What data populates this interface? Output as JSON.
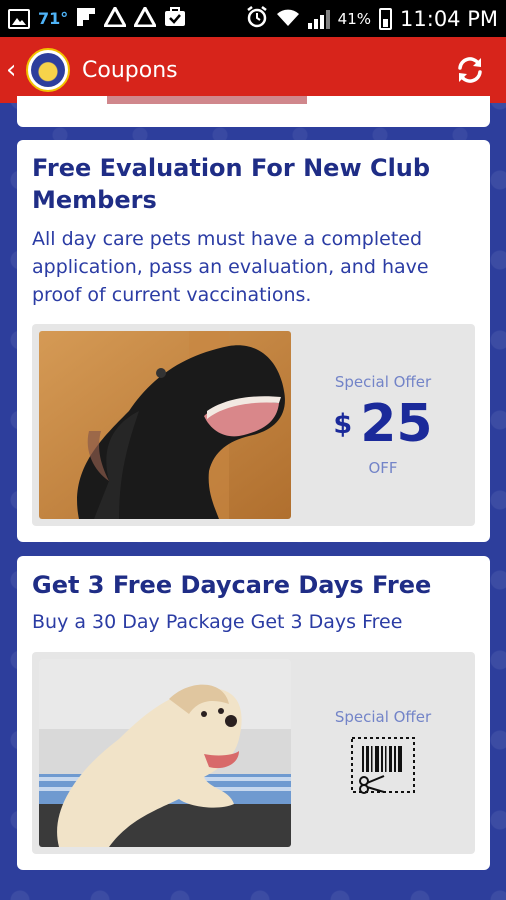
{
  "status_bar": {
    "temperature": "71°",
    "battery_percent": "41%",
    "time": "11:04 PM"
  },
  "app_bar": {
    "title": "Coupons",
    "back_icon": "chevron-left-icon",
    "refresh_icon": "refresh-icon",
    "accent_color": "#d7241b"
  },
  "coupons": [
    {
      "title": "Free Evaluation For New Club Members",
      "description": "All day care pets must have a completed application, pass an evaluation, and have proof of current vaccinations.",
      "photo": "black-labrador-photo",
      "special_offer_label": "Special Offer",
      "currency": "$",
      "amount": "25",
      "off_label": "OFF"
    },
    {
      "title": "Get 3 Free Daycare Days Free",
      "description": "Buy a 30 Day Package Get 3 Days Free",
      "photo": "golden-retriever-photo",
      "special_offer_label": "Special Offer",
      "barcode_icon": "barcode-scissors-icon"
    }
  ]
}
